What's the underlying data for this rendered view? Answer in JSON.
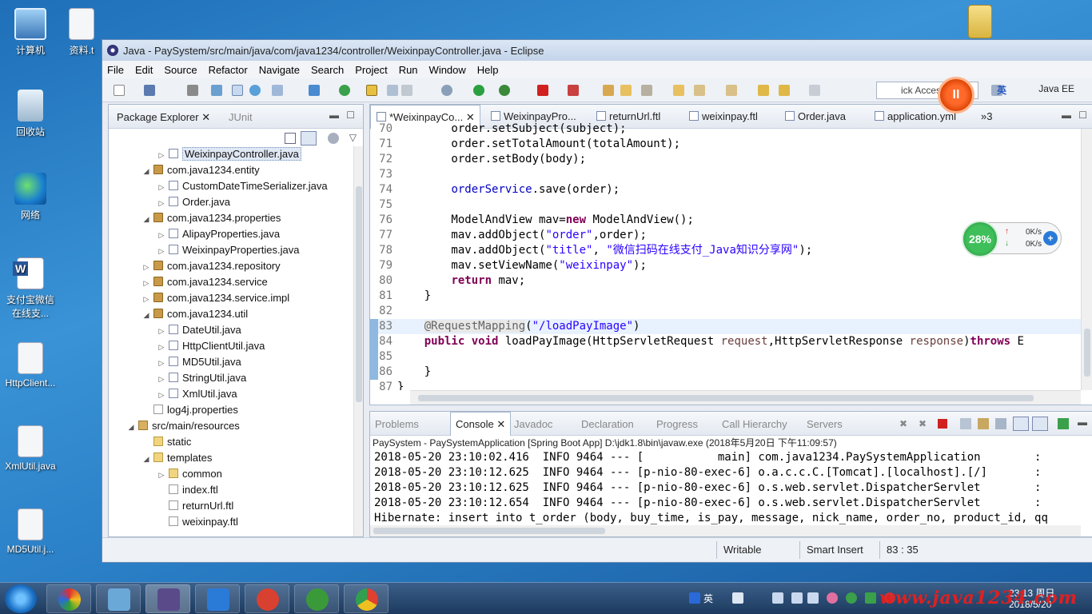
{
  "desktop": {
    "icons": [
      {
        "label": "计算机"
      },
      {
        "label": "资料.t"
      },
      {
        "label": "回收站"
      },
      {
        "label": "网络"
      },
      {
        "label": "支付宝微信在线支..."
      },
      {
        "label": "HttpClient..."
      },
      {
        "label": "XmlUtil.java"
      },
      {
        "label": "MD5Util.j..."
      }
    ]
  },
  "window": {
    "title": "Java - PaySystem/src/main/java/com/java1234/controller/WeixinpayController.java - Eclipse"
  },
  "menu": [
    "File",
    "Edit",
    "Source",
    "Refactor",
    "Navigate",
    "Search",
    "Project",
    "Run",
    "Window",
    "Help"
  ],
  "toolbar": {
    "quick_access": "ick Access",
    "ime": "英",
    "record_icon": "II",
    "perspective": "Java EE"
  },
  "package_explorer": {
    "tab": "Package Explorer",
    "tab2": "JUnit",
    "rows": [
      {
        "label": "WeixinpayController.java",
        "indent": 4,
        "type": "java",
        "twisty": "▷",
        "selected": true
      },
      {
        "label": "com.java1234.entity",
        "indent": 3,
        "type": "pkg",
        "twisty": "◢"
      },
      {
        "label": "CustomDateTimeSerializer.java",
        "indent": 4,
        "type": "java",
        "twisty": "▷"
      },
      {
        "label": "Order.java",
        "indent": 4,
        "type": "java",
        "twisty": "▷"
      },
      {
        "label": "com.java1234.properties",
        "indent": 3,
        "type": "pkg",
        "twisty": "◢"
      },
      {
        "label": "AlipayProperties.java",
        "indent": 4,
        "type": "java",
        "twisty": "▷"
      },
      {
        "label": "WeixinpayProperties.java",
        "indent": 4,
        "type": "java",
        "twisty": "▷"
      },
      {
        "label": "com.java1234.repository",
        "indent": 3,
        "type": "pkg",
        "twisty": "▷"
      },
      {
        "label": "com.java1234.service",
        "indent": 3,
        "type": "pkg",
        "twisty": "▷"
      },
      {
        "label": "com.java1234.service.impl",
        "indent": 3,
        "type": "pkg",
        "twisty": "▷"
      },
      {
        "label": "com.java1234.util",
        "indent": 3,
        "type": "pkg",
        "twisty": "◢"
      },
      {
        "label": "DateUtil.java",
        "indent": 4,
        "type": "java",
        "twisty": "▷"
      },
      {
        "label": "HttpClientUtil.java",
        "indent": 4,
        "type": "java",
        "twisty": "▷"
      },
      {
        "label": "MD5Util.java",
        "indent": 4,
        "type": "java",
        "twisty": "▷"
      },
      {
        "label": "StringUtil.java",
        "indent": 4,
        "type": "java",
        "twisty": "▷"
      },
      {
        "label": "XmlUtil.java",
        "indent": 4,
        "type": "java",
        "twisty": "▷"
      },
      {
        "label": "log4j.properties",
        "indent": 3,
        "type": "file",
        "twisty": ""
      },
      {
        "label": "src/main/resources",
        "indent": 2,
        "type": "src",
        "twisty": "◢"
      },
      {
        "label": "static",
        "indent": 3,
        "type": "folder",
        "twisty": ""
      },
      {
        "label": "templates",
        "indent": 3,
        "type": "folder",
        "twisty": "◢"
      },
      {
        "label": "common",
        "indent": 4,
        "type": "folder",
        "twisty": "▷"
      },
      {
        "label": "index.ftl",
        "indent": 4,
        "type": "file",
        "twisty": ""
      },
      {
        "label": "returnUrl.ftl",
        "indent": 4,
        "type": "file",
        "twisty": ""
      },
      {
        "label": "weixinpay.ftl",
        "indent": 4,
        "type": "file",
        "twisty": ""
      }
    ]
  },
  "editor": {
    "tabs": [
      {
        "label": "*WeixinpayCo...",
        "active": true
      },
      {
        "label": "WeixinpayPro..."
      },
      {
        "label": "returnUrl.ftl"
      },
      {
        "label": "weixinpay.ftl"
      },
      {
        "label": "Order.java"
      },
      {
        "label": "application.yml"
      },
      {
        "label": "»3"
      }
    ],
    "lines": [
      {
        "n": "70",
        "segs": [
          [
            "",
            "        order.setSubject(subject);"
          ]
        ]
      },
      {
        "n": "71",
        "segs": [
          [
            "",
            "        order.setTotalAmount(totalAmount);"
          ]
        ]
      },
      {
        "n": "72",
        "segs": [
          [
            "",
            "        order.setBody(body);"
          ]
        ]
      },
      {
        "n": "73",
        "segs": [
          [
            "",
            ""
          ]
        ]
      },
      {
        "n": "74",
        "segs": [
          [
            "",
            "        "
          ],
          [
            "fld",
            "orderService"
          ],
          [
            "",
            ".save(order);"
          ]
        ]
      },
      {
        "n": "75",
        "segs": [
          [
            "",
            ""
          ]
        ]
      },
      {
        "n": "76",
        "segs": [
          [
            "",
            "        ModelAndView mav="
          ],
          [
            "kw",
            "new"
          ],
          [
            "",
            " ModelAndView();"
          ]
        ]
      },
      {
        "n": "77",
        "segs": [
          [
            "",
            "        mav.addObject("
          ],
          [
            "str",
            "\"order\""
          ],
          [
            "",
            ",order);"
          ]
        ]
      },
      {
        "n": "78",
        "segs": [
          [
            "",
            "        mav.addObject("
          ],
          [
            "str",
            "\"title\""
          ],
          [
            "",
            ", "
          ],
          [
            "str",
            "\"微信扫码在线支付_Java知识分享网\""
          ],
          [
            "",
            ");"
          ]
        ]
      },
      {
        "n": "79",
        "segs": [
          [
            "",
            "        mav.setViewName("
          ],
          [
            "str",
            "\"weixinpay\""
          ],
          [
            "",
            ");"
          ]
        ]
      },
      {
        "n": "80",
        "segs": [
          [
            "",
            "        "
          ],
          [
            "kw",
            "return"
          ],
          [
            "",
            " mav;"
          ]
        ]
      },
      {
        "n": "81",
        "segs": [
          [
            "",
            "    }"
          ]
        ]
      },
      {
        "n": "82",
        "segs": [
          [
            "",
            ""
          ]
        ]
      },
      {
        "n": "83",
        "segs": [
          [
            "",
            "    "
          ],
          [
            "ann",
            "@RequestMapping"
          ],
          [
            "",
            "("
          ],
          [
            "str",
            "\"/loadPayImage\""
          ],
          [
            "",
            ")"
          ]
        ],
        "current": true,
        "mark": true
      },
      {
        "n": "84",
        "segs": [
          [
            "",
            "    "
          ],
          [
            "kw",
            "public"
          ],
          [
            "",
            " "
          ],
          [
            "kw",
            "void"
          ],
          [
            "",
            " loadPayImage(HttpServletRequest "
          ],
          [
            "prm",
            "request"
          ],
          [
            "",
            ",HttpServletResponse "
          ],
          [
            "prm",
            "response"
          ],
          [
            "",
            ")"
          ],
          [
            "kw",
            "throws"
          ],
          [
            "",
            " E"
          ]
        ],
        "mark": true
      },
      {
        "n": "85",
        "segs": [
          [
            "",
            ""
          ]
        ],
        "mark": true
      },
      {
        "n": "86",
        "segs": [
          [
            "",
            "    }"
          ]
        ],
        "mark": true
      },
      {
        "n": "87",
        "segs": [
          [
            "",
            "}"
          ]
        ]
      }
    ]
  },
  "netspeed": {
    "percent": "28%",
    "up": "0K/s",
    "down": "0K/s"
  },
  "console": {
    "tabs": [
      "Problems",
      "Console",
      "Javadoc",
      "Declaration",
      "Progress",
      "Call Hierarchy",
      "Servers"
    ],
    "active_tab": "Console",
    "description": "PaySystem - PaySystemApplication [Spring Boot App] D:\\jdk1.8\\bin\\javaw.exe (2018年5月20日 下午11:09:57)",
    "lines": [
      "2018-05-20 23:10:02.416  INFO 9464 --- [           main] com.java1234.PaySystemApplication        :",
      "2018-05-20 23:10:12.625  INFO 9464 --- [p-nio-80-exec-6] o.a.c.c.C.[Tomcat].[localhost].[/]       :",
      "2018-05-20 23:10:12.625  INFO 9464 --- [p-nio-80-exec-6] o.s.web.servlet.DispatcherServlet        :",
      "2018-05-20 23:10:12.654  INFO 9464 --- [p-nio-80-exec-6] o.s.web.servlet.DispatcherServlet        :",
      "Hibernate: insert into t_order (body, buy_time, is_pay, message, nick_name, order_no, product_id, qq"
    ]
  },
  "status": {
    "writable": "Writable",
    "insert": "Smart Insert",
    "position": "83 : 35"
  },
  "taskbar": {
    "ime": "英",
    "time": "23:13 周日",
    "date": "2018/5/20",
    "watermark": "www.java1234.com"
  },
  "colors": {
    "accent": "#2a7fc6",
    "keyword": "#7f0055",
    "string": "#2a00ff"
  }
}
